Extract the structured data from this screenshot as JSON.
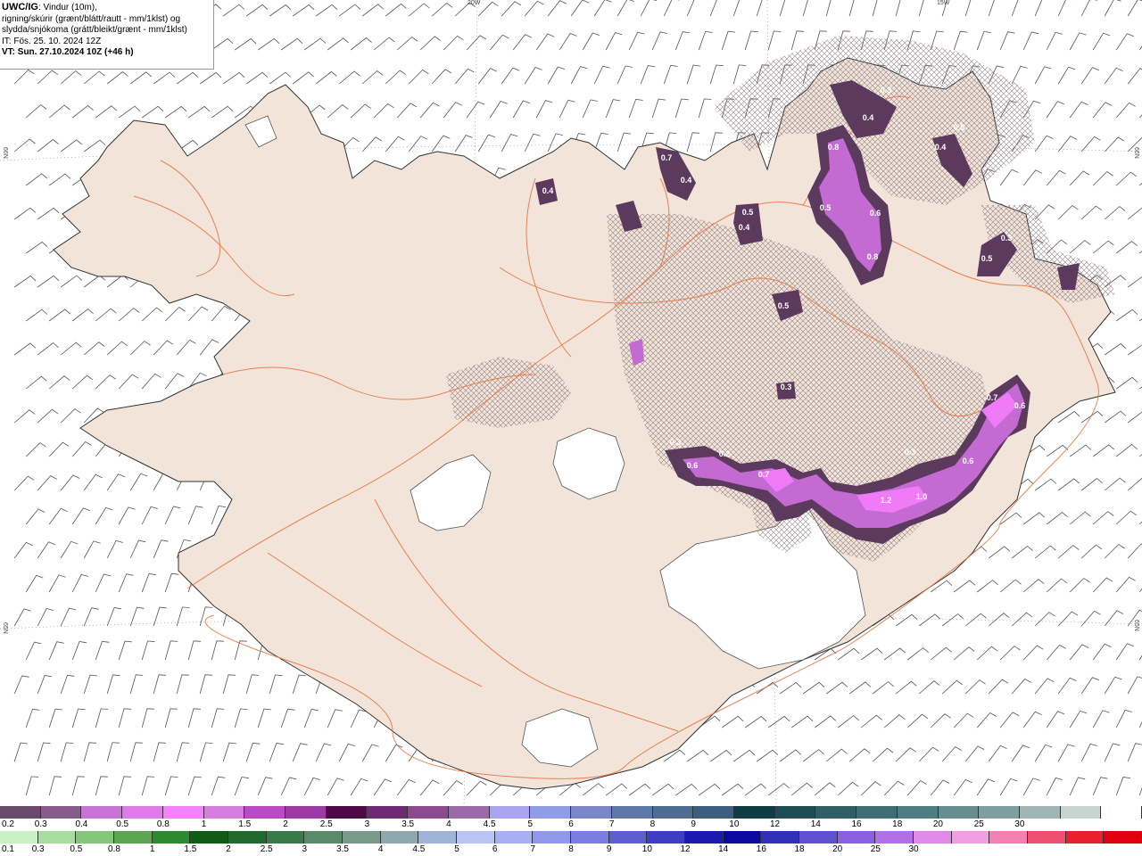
{
  "header": {
    "line1_bold": "UWC/IG",
    "line1_rest": ": Vindur (10m),",
    "line2": "rigning/skúrir (grænt/blátt/rautt - mm/1klst) og",
    "line3": "slydda/snjókoma (grátt/bleikt/grænt - mm/1klst)",
    "line4": "IT: Fös. 25. 10. 2024 12Z",
    "line5": "VT: Sun. 27.10.2024 10Z (+46 h)"
  },
  "coords": {
    "top_20w": "20W",
    "top_15w": "15W",
    "left_66n": "66N",
    "left_65n": "65N",
    "right_66n": "66N",
    "right_65n": "65N"
  },
  "colors": {
    "land": "#f2e4d8",
    "roads": "#e8703a",
    "snow_light": "#c46ad3",
    "snow_mid": "#8e4aa0",
    "snow_dark": "#5c3a5e",
    "snow_bright": "#f07bf7"
  },
  "precip_labels": [
    "0.3",
    "0.4",
    "0.8",
    "0.5",
    "0.6",
    "0.8",
    "0.4",
    "0.5",
    "0.4",
    "0.4",
    "0.4",
    "0.5",
    "0.3",
    "0.5",
    "0.3",
    "0.3",
    "0.6",
    "0.2",
    "0.7",
    "0.7",
    "0.6",
    "1.2",
    "1.0",
    "0.6",
    "0.3",
    "0.5",
    "0.7"
  ],
  "legend_snow": {
    "colors": [
      "#6a4a6a",
      "#875c8a",
      "#c873d6",
      "#e07ae9",
      "#f281fa",
      "#d67ee0",
      "#b94cc6",
      "#9e3aa3",
      "#4e0a46",
      "#6e2a74",
      "#8b4b8e",
      "#9a6aa9",
      "#a9a3f0",
      "#8f9de6",
      "#7c85c8",
      "#5e78a8",
      "#4e6b92",
      "#3e5e80",
      "#0f3b44",
      "#1e4c55",
      "#2e5e66",
      "#3d6e74",
      "#4f7e82",
      "#668e90",
      "#7e9fa0",
      "#a1b6b4",
      "#c8d4d0",
      "#ffffff"
    ],
    "labels": [
      "0.2",
      "0.3",
      "0.4",
      "0.5",
      "0.8",
      "1",
      "1.5",
      "2",
      "2.5",
      "3",
      "3.5",
      "4",
      "4.5",
      "5",
      "6",
      "7",
      "8",
      "9",
      "10",
      "12",
      "14",
      "16",
      "18",
      "20",
      "25",
      "30"
    ]
  },
  "legend_rain": {
    "colors": [
      "#c9f2c4",
      "#a8dda0",
      "#86c67c",
      "#5ca552",
      "#2e8a2e",
      "#0f5c14",
      "#1f6a2c",
      "#3a7a4a",
      "#5a8a6a",
      "#7a9a8a",
      "#8fa8b0",
      "#a0b4d8",
      "#b8c4f2",
      "#a8b0f4",
      "#9098ec",
      "#7a7ee0",
      "#5e5ed0",
      "#3e3ec2",
      "#1a1ab0",
      "#0a0aa0",
      "#3030b8",
      "#6050d0",
      "#8a60e0",
      "#b070e8",
      "#e08ae8",
      "#f0a0e0",
      "#f280b0",
      "#f05070",
      "#e82030",
      "#e00010"
    ],
    "labels": [
      "0.1",
      "0.3",
      "0.5",
      "0.8",
      "1",
      "1.5",
      "2",
      "2.5",
      "3",
      "3.5",
      "4",
      "4.5",
      "5",
      "6",
      "7",
      "8",
      "9",
      "10",
      "12",
      "14",
      "16",
      "18",
      "20",
      "25",
      "30"
    ]
  }
}
